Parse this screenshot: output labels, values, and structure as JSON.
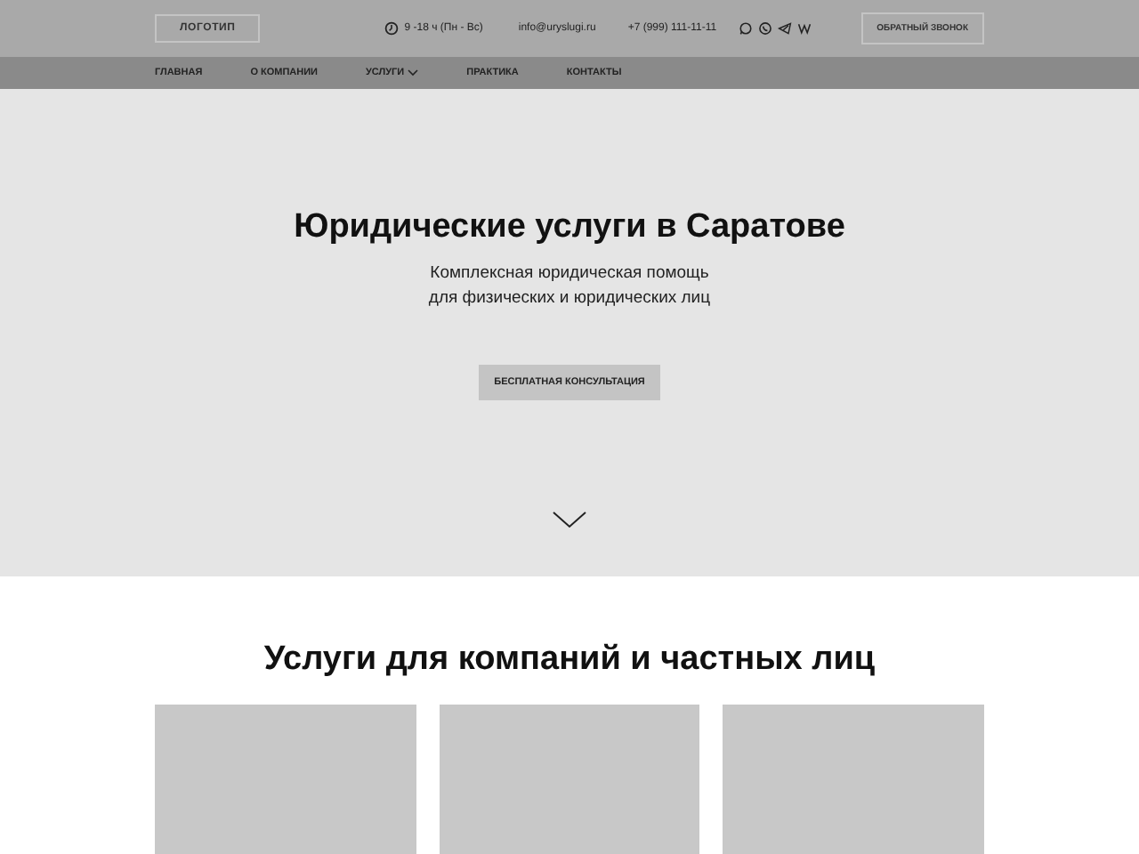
{
  "header": {
    "logo": "ЛОГОТИП",
    "hours": "9 -18 ч (Пн - Вс)",
    "email": "info@uryslugi.ru",
    "phone": "+7 (999) 111-11-11",
    "callback_button": "ОБРАТНЫЙ ЗВОНОК"
  },
  "nav": [
    {
      "label": "ГЛАВНАЯ",
      "has_menu": false
    },
    {
      "label": "О КОМПАНИИ",
      "has_menu": false
    },
    {
      "label": "УСЛУГИ",
      "has_menu": true
    },
    {
      "label": "ПРАКТИКА",
      "has_menu": false
    },
    {
      "label": "КОНТАКТЫ",
      "has_menu": false
    }
  ],
  "hero": {
    "title": "Юридические услуги в Саратове",
    "subtitle_lines": [
      "Комплексная юридическая помощь",
      "для физических и юридических лиц"
    ],
    "button": "БЕСПЛАТНАЯ КОНСУЛЬТАЦИЯ"
  },
  "services": {
    "title": "Услуги для компаний и частных лиц",
    "cards": [
      {
        "kind": "placeholder"
      },
      {
        "kind": "placeholder"
      },
      {
        "kind": "placeholder"
      }
    ]
  }
}
